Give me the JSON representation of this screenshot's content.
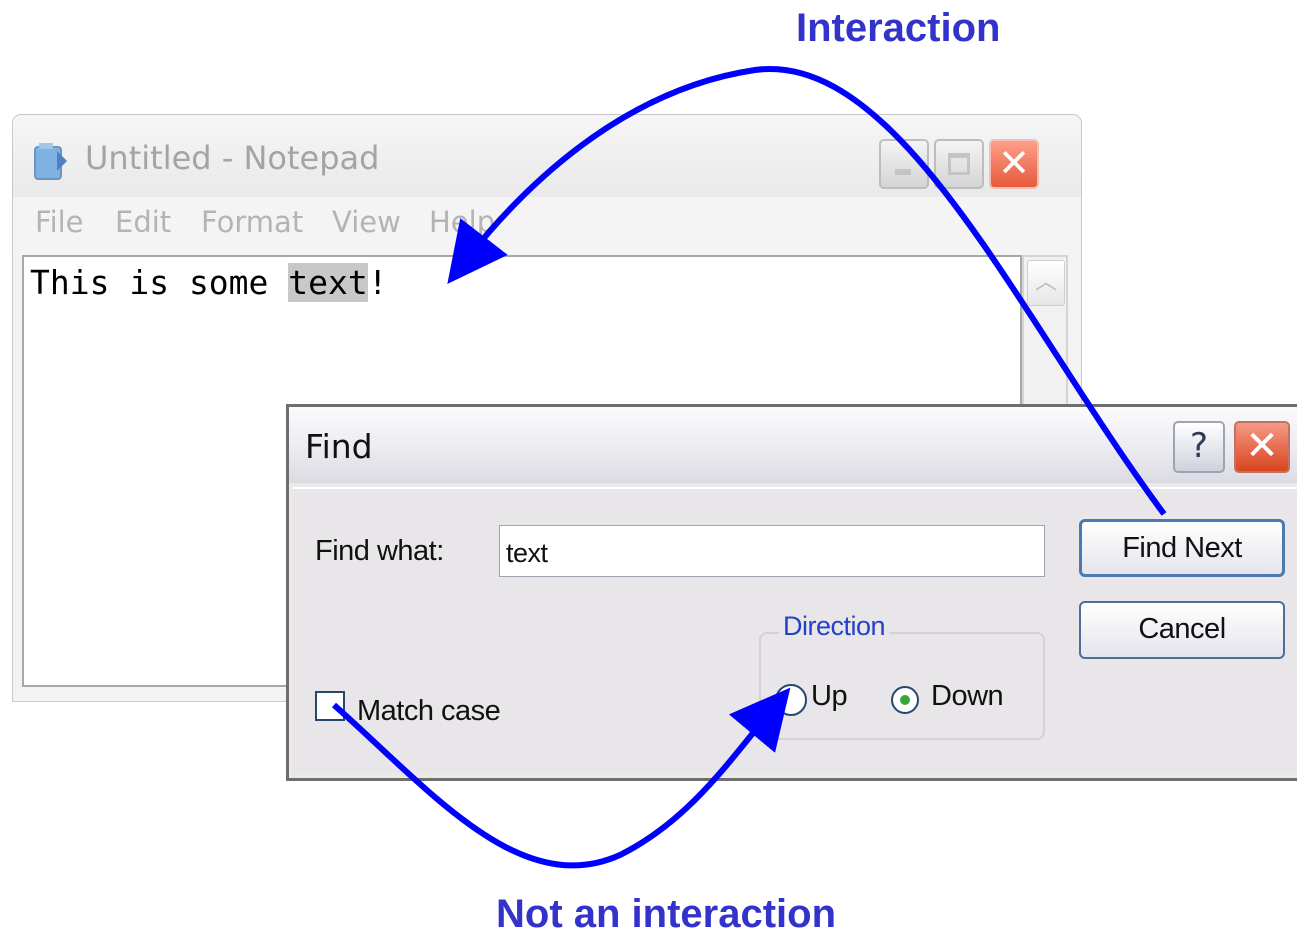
{
  "annotations": {
    "top_label": "Interaction",
    "bottom_label": "Not an interaction",
    "arrow_color": "#0000ff",
    "label_color": "#3333cc"
  },
  "notepad": {
    "title": "Untitled - Notepad",
    "icon": "notepad-icon",
    "window_buttons": {
      "minimize_icon": "minimize-icon",
      "maximize_icon": "maximize-icon",
      "close_icon": "close-icon",
      "close_glyph": "✕"
    },
    "menu": [
      "File",
      "Edit",
      "Format",
      "View",
      "Help"
    ],
    "text_before": "This is some ",
    "text_selected": "text",
    "text_after": "!",
    "scroll_up_glyph": "︿"
  },
  "find_dialog": {
    "title": "Find",
    "help_glyph": "?",
    "close_glyph": "✕",
    "find_what_label": "Find what:",
    "find_what_value": "text",
    "find_next_label": "Find Next",
    "cancel_label": "Cancel",
    "direction": {
      "legend": "Direction",
      "options": [
        "Up",
        "Down"
      ],
      "selected": "Down"
    },
    "match_case_label": "Match case",
    "match_case_checked": false
  }
}
